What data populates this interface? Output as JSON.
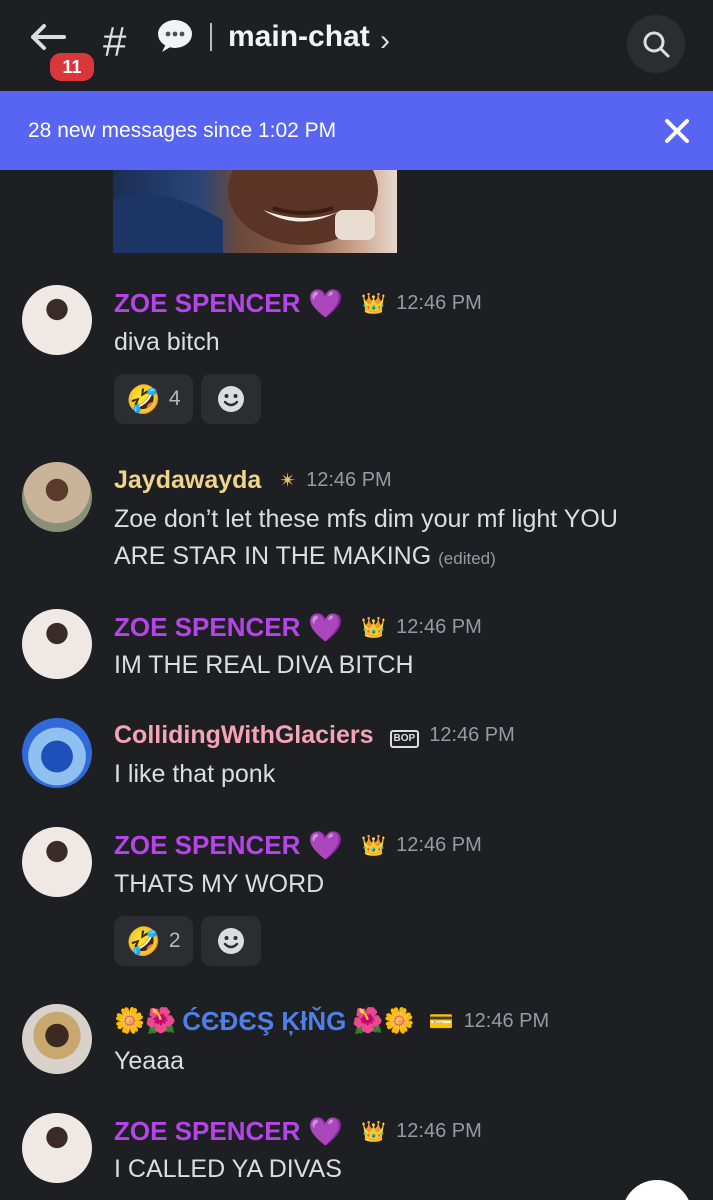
{
  "header": {
    "unread_badge": "11",
    "hash_symbol": "#",
    "channel_name": "main-chat",
    "chevron": "›"
  },
  "banner": {
    "text": "28 new messages since 1:02 PM"
  },
  "messages": [
    {
      "author": "ZOE SPENCER",
      "name_emoji": "💜",
      "role_icon": "👑",
      "timestamp": "12:46 PM",
      "text": "diva bitch",
      "reactions": [
        {
          "emoji": "🤣",
          "count": "4"
        }
      ]
    },
    {
      "author": "Jaydawayda",
      "role_icon": "✴",
      "timestamp": "12:46 PM",
      "text_line1": "Zoe don’t let these mfs dim your mf light YOU",
      "text_line2": "ARE STAR IN THE MAKING",
      "edited": "(edited)"
    },
    {
      "author": "ZOE SPENCER",
      "name_emoji": "💜",
      "role_icon": "👑",
      "timestamp": "12:46 PM",
      "text": "IM THE REAL DIVA BITCH"
    },
    {
      "author": "CollidingWithGlaciers",
      "role_icon": "BOP",
      "timestamp": "12:46 PM",
      "text": "I like that ponk"
    },
    {
      "author": "ZOE SPENCER",
      "name_emoji": "💜",
      "role_icon": "👑",
      "timestamp": "12:46 PM",
      "text": "THATS MY WORD",
      "reactions": [
        {
          "emoji": "🤣",
          "count": "2"
        }
      ]
    },
    {
      "author_prefix": "🌼🌺",
      "author": "ĆЄĐЄŞ ĶłŇG",
      "author_suffix": "🌺🌼",
      "role_icon": "💳",
      "timestamp": "12:46 PM",
      "text": "Yeaaa"
    },
    {
      "author": "ZOE SPENCER",
      "name_emoji": "💜",
      "role_icon": "👑",
      "timestamp": "12:46 PM",
      "text": "I CALLED YA DIVAS"
    }
  ],
  "colors": {
    "background": "#1e1f22",
    "banner": "#5865f2",
    "badge": "#da373c",
    "zoe_name": "#b545e8",
    "jay_name": "#f0d48a",
    "glaciers_name": "#f5a3b8",
    "cedes_name": "#4f7fe8",
    "timestamp": "#949ba4"
  }
}
